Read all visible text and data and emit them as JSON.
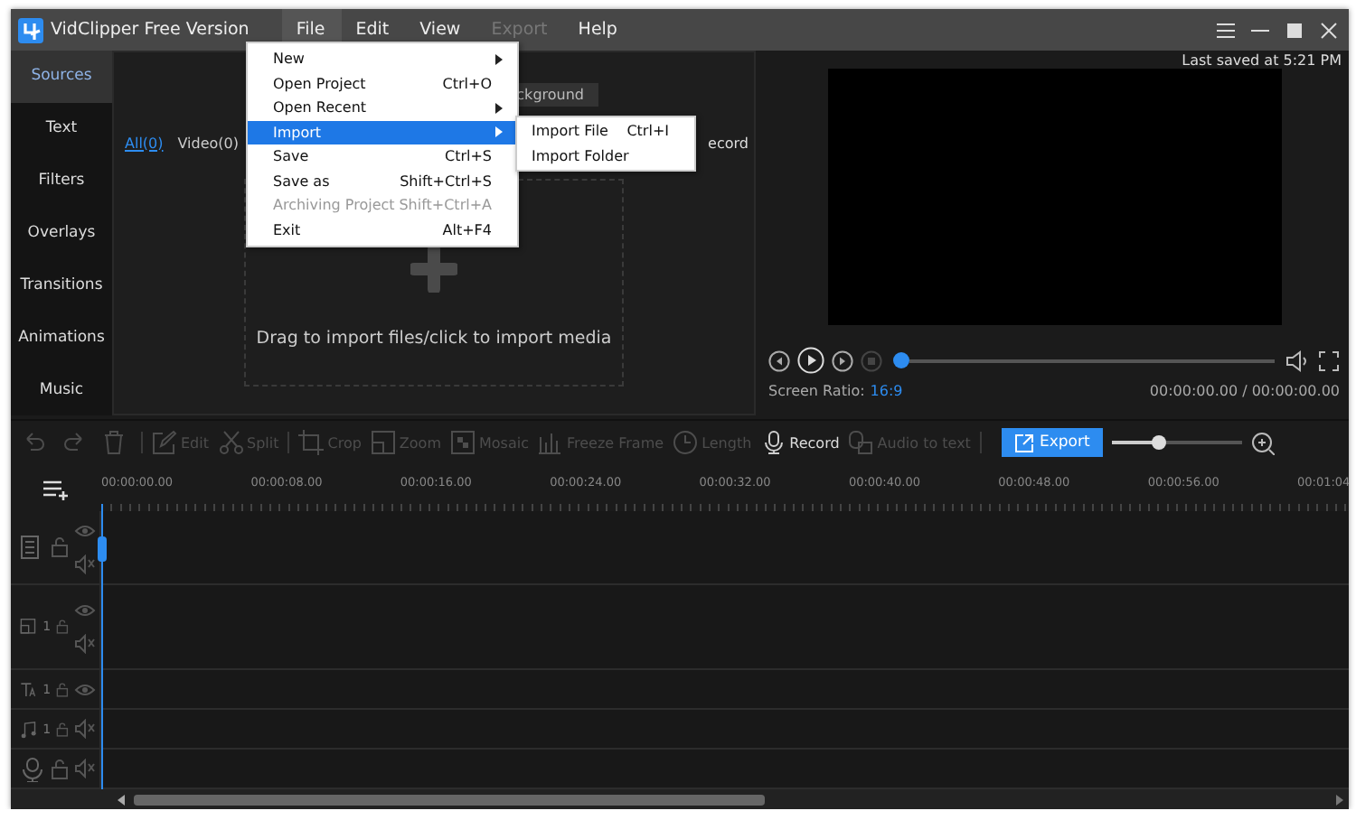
{
  "window": {
    "title": "VidClipper Free Version"
  },
  "menubar": [
    {
      "label": "File",
      "selected": true,
      "disabled": false
    },
    {
      "label": "Edit",
      "selected": false,
      "disabled": false
    },
    {
      "label": "View",
      "selected": false,
      "disabled": false
    },
    {
      "label": "Export",
      "selected": false,
      "disabled": true
    },
    {
      "label": "Help",
      "selected": false,
      "disabled": false
    }
  ],
  "file_menu": [
    {
      "label": "New",
      "has_submenu": true,
      "selected": false,
      "disabled": false
    },
    {
      "label": "Open Project",
      "shortcut": "Ctrl+O",
      "has_submenu": false,
      "selected": false,
      "disabled": false
    },
    {
      "label": "Open Recent",
      "has_submenu": true,
      "selected": false,
      "disabled": false
    },
    {
      "label": "Import",
      "has_submenu": true,
      "selected": true,
      "disabled": false
    },
    {
      "label": "Save",
      "shortcut": "Ctrl+S",
      "has_submenu": false,
      "selected": false,
      "disabled": false
    },
    {
      "label": "Save as",
      "shortcut": "Shift+Ctrl+S",
      "has_submenu": false,
      "selected": false,
      "disabled": false
    },
    {
      "label": "Archiving Project",
      "shortcut": "Shift+Ctrl+A",
      "has_submenu": false,
      "selected": false,
      "disabled": true
    },
    {
      "label": "Exit",
      "shortcut": "Alt+F4",
      "has_submenu": false,
      "selected": false,
      "disabled": false
    }
  ],
  "import_submenu": [
    {
      "label": "Import File",
      "shortcut": "Ctrl+I"
    },
    {
      "label": "Import Folder"
    }
  ],
  "sidebar": [
    {
      "label": "Sources",
      "selected": true
    },
    {
      "label": "Text",
      "selected": false
    },
    {
      "label": "Filters",
      "selected": false
    },
    {
      "label": "Overlays",
      "selected": false
    },
    {
      "label": "Transitions",
      "selected": false
    },
    {
      "label": "Animations",
      "selected": false
    },
    {
      "label": "Music",
      "selected": false
    }
  ],
  "media": {
    "background_button": "ckground",
    "filters": [
      {
        "label": "All(0)",
        "selected": true
      },
      {
        "label": "Video(0)",
        "selected": false
      }
    ],
    "record_link": "ecord",
    "drop_hint": "Drag to import files/click to import media"
  },
  "preview": {
    "last_saved": "Last saved at 5:21 PM",
    "progress": {
      "level": 0
    },
    "ratio_label": "Screen Ratio:",
    "ratio_value": "16:9",
    "time": "00:00:00.00 / 00:00:00.00"
  },
  "toolbar": [
    {
      "kind": "icon",
      "disabled": true
    },
    {
      "kind": "icon",
      "disabled": true
    },
    {
      "kind": "icon",
      "disabled": true
    },
    {
      "kind": "divider"
    },
    {
      "kind": "tool",
      "label": "Edit",
      "disabled": true
    },
    {
      "kind": "tool",
      "label": "Split",
      "disabled": true
    },
    {
      "kind": "divider"
    },
    {
      "kind": "tool",
      "label": "Crop",
      "disabled": true
    },
    {
      "kind": "tool",
      "label": "Zoom",
      "disabled": true
    },
    {
      "kind": "tool",
      "label": "Mosaic",
      "disabled": true
    },
    {
      "kind": "tool",
      "label": "Freeze Frame",
      "disabled": true
    },
    {
      "kind": "tool",
      "label": "Length",
      "disabled": true
    },
    {
      "kind": "tool",
      "label": "Record",
      "disabled": false
    },
    {
      "kind": "tool",
      "label": "Audio to text",
      "disabled": true
    },
    {
      "kind": "divider"
    }
  ],
  "export_button": "Export",
  "zoom_slider": {
    "level": 0.37
  },
  "timeline": {
    "ruler": [
      "00:00:00.00",
      "00:00:08.00",
      "00:00:16.00",
      "00:00:24.00",
      "00:00:32.00",
      "00:00:40.00",
      "00:00:48.00",
      "00:00:56.00",
      "00:01:04"
    ],
    "tracks": [
      {
        "kind": "video"
      },
      {
        "kind": "overlay",
        "count": "1"
      },
      {
        "kind": "text",
        "count": "1"
      },
      {
        "kind": "music",
        "count": "1"
      },
      {
        "kind": "voice"
      }
    ]
  }
}
